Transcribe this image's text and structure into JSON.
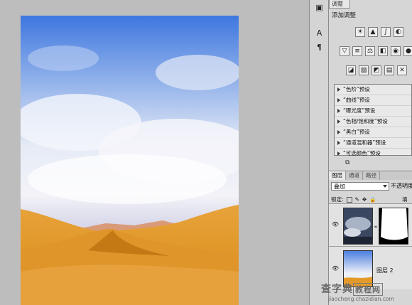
{
  "adjustments_panel": {
    "tab_label": "调整",
    "title": "添加调整",
    "presets": [
      "“色阶”预设",
      "“曲线”预设",
      "“曝光度”预设",
      "“色相/饱和度”预设",
      "“黑白”预设",
      "“通道混和器”预设",
      "“可选颜色”预设"
    ]
  },
  "layers_panel": {
    "tabs": [
      "图层",
      "通道",
      "路径"
    ],
    "blend_mode": "叠加",
    "opacity_label": "不透明度",
    "lock_label": "锁定:",
    "fill_label": "填充",
    "layers": [
      {
        "name": ""
      },
      {
        "name": "图层 2"
      }
    ]
  },
  "watermark": {
    "main_prefix": "查字典",
    "main_box": "教程网",
    "url": "jiaocheng.chazidian.com"
  },
  "colors": {
    "sky_top": "#3f7be3",
    "sand": "#e39a2a",
    "panel_bg": "#d6d6d6",
    "canvas_bg": "#bdbdbd"
  }
}
